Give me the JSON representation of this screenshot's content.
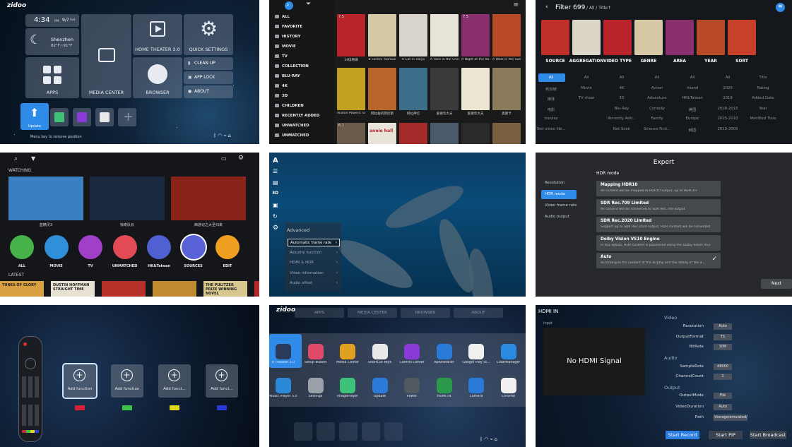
{
  "home": {
    "logo": "zidoo",
    "time": "4:34",
    "time_suffix": "PM",
    "date": "9/7",
    "weekday": "Sat",
    "city": "Shenzhen",
    "temp": "82°F~91°F",
    "apps_label": "APPS",
    "media_center_label": "MEDIA CENTER",
    "home_theater_label": "HOME THEATER 3.0",
    "quick_settings_label": "QUICK SETTINGS",
    "browser_label": "BROWSER",
    "clean_up_label": "CLEAN UP",
    "app_lock_label": "APP LOCK",
    "about_label": "ABOUT",
    "update_label": "Update",
    "hint": "Menu key to remove position"
  },
  "library": {
    "menu": [
      "ALL",
      "FAVORITE",
      "HISTORY",
      "MOVIE",
      "TV",
      "COLLECTION",
      "BLU-RAY",
      "4K",
      "3D",
      "CHILDREN",
      "RECENTLY ADDED",
      "UNWATCHED",
      "UNMATCHED"
    ],
    "row1": [
      {
        "title": "34街奇缘",
        "rating": "7.5",
        "color": "#b8242a"
      },
      {
        "title": "8 contes moraux",
        "rating": "",
        "color": "#d7c8a6"
      },
      {
        "title": "A Cat in Tokyo",
        "rating": "",
        "color": "#d9d4cc"
      },
      {
        "title": "A Face in the Crowd",
        "rating": "",
        "color": "#e8e3d8"
      },
      {
        "title": "A Night at the Ro...",
        "rating": "7.5",
        "color": "#8a2f6e"
      },
      {
        "title": "A Walk in the Sun",
        "rating": "",
        "color": "#b84a28"
      }
    ],
    "row2": [
      {
        "title": "Avalon Powers: El...",
        "rating": "",
        "color": "#c2a020"
      },
      {
        "title": "阿拉伯的劳伦斯",
        "rating": "",
        "color": "#b8642a"
      },
      {
        "title": "阿拉神灯",
        "rating": "",
        "color": "#3d6e8a"
      },
      {
        "title": "爱德华大夫",
        "rating": "",
        "color": "#3a3a3a"
      },
      {
        "title": "爱德华大夫",
        "rating": "",
        "color": "#ece5d0"
      },
      {
        "title": "奥斯卡",
        "rating": "",
        "color": "#8a7a5a"
      }
    ],
    "row3": [
      {
        "title": "",
        "rating": "6.1",
        "color": "#6a5a4a"
      },
      {
        "title": "annie hall",
        "rating": "",
        "color": "#e9e4da"
      },
      {
        "title": "",
        "rating": "",
        "color": "#a52a2a"
      },
      {
        "title": "",
        "rating": "",
        "color": "#4a5a6a"
      },
      {
        "title": "",
        "rating": "",
        "color": "#2a2a2a"
      },
      {
        "title": "",
        "rating": "",
        "color": "#7a6040"
      }
    ]
  },
  "filter": {
    "title": "Filter 699",
    "path": "/ All / Title↑",
    "categories": [
      {
        "label": "SOURCE",
        "color": "#c0302a"
      },
      {
        "label": "AGGREGATION",
        "color": "#dcd6c8"
      },
      {
        "label": "VIDEO TYPE",
        "color": "#b8242a"
      },
      {
        "label": "GENRE",
        "color": "#d7c8a6"
      },
      {
        "label": "AREA",
        "color": "#8a2f6e"
      },
      {
        "label": "YEAR",
        "color": "#b84a28"
      },
      {
        "label": "SORT",
        "color": "#c9402a"
      }
    ],
    "columns": [
      [
        "All",
        "新加坡",
        "媒体",
        "电影",
        "movies",
        "Test video libr..."
      ],
      [
        "All",
        "Movie",
        "TV show"
      ],
      [
        "All",
        "4K",
        "3D",
        "Blu-Ray",
        "Recently Add...",
        "Not Seen"
      ],
      [
        "All",
        "Action",
        "Adventure",
        "Comedy",
        "Family",
        "Science Ficti..."
      ],
      [
        "All",
        "Inland",
        "HK&Taiwan",
        "美国",
        "Europe",
        "韩国"
      ],
      [
        "All",
        "2020",
        "2019",
        "2018-2015",
        "2015-2010",
        "2010-2005"
      ],
      [
        "Title",
        "Rating",
        "Added Date",
        "Year",
        "Modified Time"
      ]
    ]
  },
  "poster_wall": {
    "watching_label": "WATCHING",
    "latest_label": "LATEST",
    "watching": [
      {
        "title": "蓝精灵3",
        "color": "#3a7fc0"
      },
      {
        "title": "惊奇队长",
        "color": "#1a2a3e"
      },
      {
        "title": "西游记之大圣归来",
        "color": "#8a2418"
      }
    ],
    "circles": [
      {
        "label": "ALL",
        "color": "#48b24a"
      },
      {
        "label": "MOVIE",
        "color": "#2f8fd8"
      },
      {
        "label": "TV",
        "color": "#a13fc9"
      },
      {
        "label": "UNMATCHED",
        "color": "#e24b55"
      },
      {
        "label": "HK&Taiwan",
        "color": "#5060d0"
      },
      {
        "label": "SOURCES",
        "color": "#5862d6"
      },
      {
        "label": "EDIT",
        "color": "#f0a020"
      }
    ],
    "latest": [
      {
        "title": "TUNES OF GLORY",
        "color": "#d8a040"
      },
      {
        "title": "DUSTIN HOFFMAN STRAIGHT TIME",
        "color": "#e8e2d4"
      },
      {
        "title": "",
        "color": "#b8302a"
      },
      {
        "title": "",
        "color": "#c08a30"
      },
      {
        "title": "THE PULITZER PRIZE WINNING NOVEL",
        "color": "#d8c890"
      },
      {
        "title": "",
        "color": "#b02a2a"
      }
    ]
  },
  "player": {
    "advanced_label": "Advanced",
    "options": [
      "Automatic frame rate",
      "Resume function",
      "HDMI & HDR",
      "Video information",
      "Audio offset"
    ]
  },
  "expert": {
    "title": "Expert",
    "menu": [
      "Resolution",
      "HDR mode",
      "Video frame rate",
      "Audio output"
    ],
    "section": "HDR mode",
    "options": [
      {
        "title": "Mapping HDR10",
        "desc": "All content will be mapped to HDR10 output, up to HDR10+"
      },
      {
        "title": "SDR Rec.709 Limited",
        "desc": "All content will be converted to SDR Rec.709 output"
      },
      {
        "title": "SDR Rec.2020 Limited",
        "desc": "Support up to SDR Rec.2020 output, HDR content will be converted to S..."
      },
      {
        "title": "Dolby Vision VS10 Engine",
        "desc": "In this option, HDR content is processed using the Dolby Vision VS10 en..."
      },
      {
        "title": "Auto",
        "desc": "According to the content of the display and the ability of the d..."
      }
    ],
    "next_label": "Next"
  },
  "remote": {
    "functions": [
      {
        "label": "Add function",
        "color": "#d3223a"
      },
      {
        "label": "Add function",
        "color": "#3ec24a"
      },
      {
        "label": "Add funct...",
        "color": "#e0d81e"
      },
      {
        "label": "Add funct...",
        "color": "#2a3ad8"
      }
    ]
  },
  "launcher": {
    "logo": "zidoo",
    "top_tabs": [
      "APPS",
      "MEDIA CENTER",
      "BROWSER",
      "ABOUT"
    ],
    "apps_row1": [
      {
        "label": "e Theater 3.0",
        "color": "#2a3a5a"
      },
      {
        "label": "Setup wizard",
        "color": "#e04a6a"
      },
      {
        "label": "Media Center",
        "color": "#e0a020"
      },
      {
        "label": "ShortCut keys",
        "color": "#e8e8e8"
      },
      {
        "label": "Control Center",
        "color": "#8a3ad8"
      },
      {
        "label": "ApkInstaller",
        "color": "#2a7ad8"
      },
      {
        "label": "Google Play St...",
        "color": "#f0f0f0"
      },
      {
        "label": "ClearManager",
        "color": "#2a8ae0"
      }
    ],
    "apps_row2": [
      {
        "label": "Music Player 5.0",
        "color": "#2a8ad8"
      },
      {
        "label": "Settings",
        "color": "#9aa0a8"
      },
      {
        "label": "ImagePlayer",
        "color": "#3ec27a"
      },
      {
        "label": "Update",
        "color": "#2a7ad8"
      },
      {
        "label": "Power",
        "color": "#505860"
      },
      {
        "label": "HDMI IN",
        "color": "#2a9a4a"
      },
      {
        "label": "Camera",
        "color": "#2a7ad8"
      },
      {
        "label": "Chrome",
        "color": "#f0f0f0"
      }
    ]
  },
  "hdmi": {
    "title": "HDMI IN",
    "input_label": "Input",
    "no_signal": "No HDMI Signal",
    "video_section": "Video",
    "audio_section": "Audio",
    "output_section": "Output",
    "rows": [
      {
        "label": "Resolution",
        "value": "Auto"
      },
      {
        "label": "OutputFormat",
        "value": "TS"
      },
      {
        "label": "BitRate",
        "value": "10M"
      },
      {
        "label": "SampleRate",
        "value": "48000"
      },
      {
        "label": "ChannelCount",
        "value": "2"
      },
      {
        "label": "OutputMode",
        "value": "File"
      },
      {
        "label": "VideoDuration",
        "value": "Auto"
      },
      {
        "label": "Path",
        "value": "/storage/emulated/0/hom..."
      }
    ],
    "start_record": "Start Record",
    "start_pip": "Start PIP",
    "start_broadcast": "Start Broadcast"
  }
}
